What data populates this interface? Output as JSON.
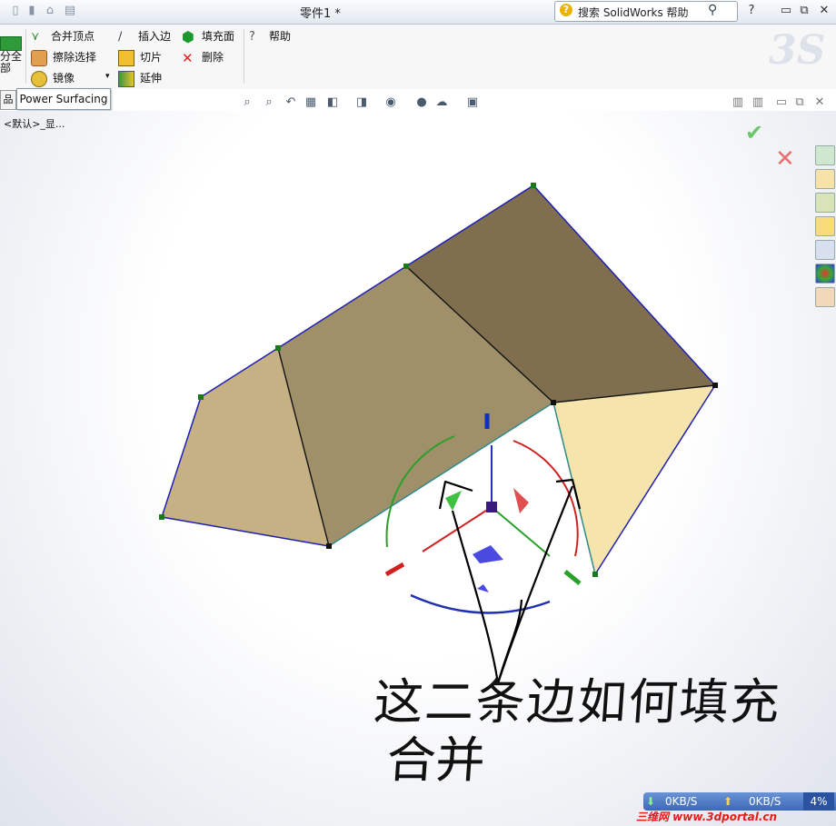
{
  "window": {
    "title": "零件1 *"
  },
  "search": {
    "placeholder": "搜索 SolidWorks 帮助"
  },
  "window_controls": {
    "help": "?",
    "minimize": "▭",
    "restore": "⧉",
    "close": "✕"
  },
  "ribbon": {
    "left_partial": "分全部",
    "col1": [
      "合并顶点",
      "擦除选择",
      "镜像"
    ],
    "col2": [
      "插入边",
      "切片",
      "延伸"
    ],
    "col3": [
      "填充面",
      "删除"
    ],
    "col4": [
      "帮助"
    ]
  },
  "tabs": {
    "product": "品",
    "power_surfacing": "Power Surfacing"
  },
  "breadcrumb": "<默认>_显...",
  "icons": {
    "ok": "check-icon",
    "cancel": "close-icon"
  },
  "colors": {
    "face_top": "#7f6f4f",
    "face_middle": "#a0906a",
    "face_left": "#c5b184",
    "face_right": "#f6e4ad",
    "edge_blue": "#2020b0",
    "ok_green": "#6cc76c",
    "cancel_red": "#e87070"
  },
  "annotation": {
    "line1": "这二条边如何填充",
    "line2": "合并"
  },
  "status": {
    "down_speed": "0KB/S",
    "up_speed": "0KB/S",
    "percent": "4%"
  },
  "watermark": "三维网 www.3dportal.cn"
}
